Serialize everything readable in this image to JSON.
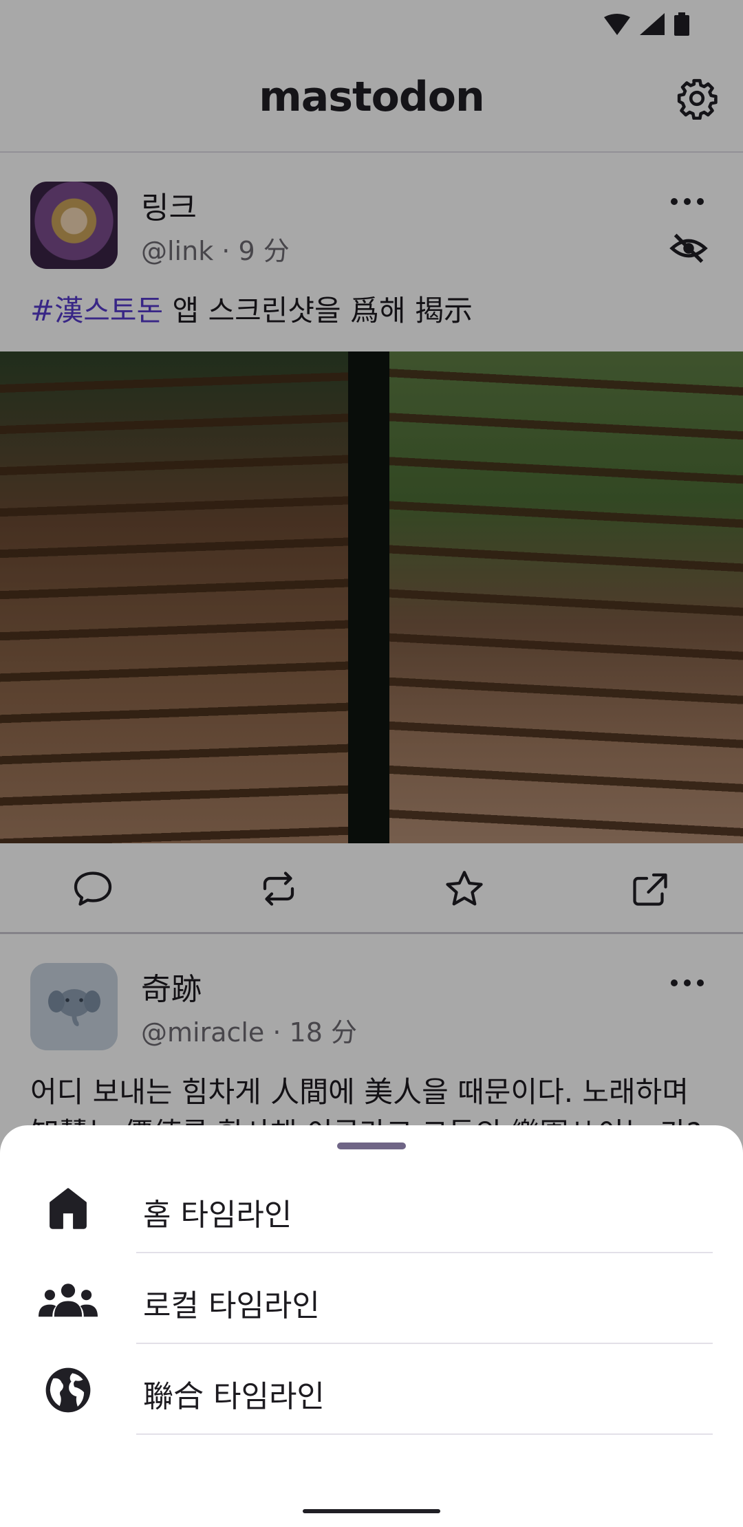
{
  "app_bar": {
    "logo_text": "mastodon"
  },
  "posts": [
    {
      "display_name": "링크",
      "handle": "@link · 9 分",
      "hashtag": "#漢스토돈",
      "text": " 앱 스크린샷을 爲해 揭示"
    },
    {
      "display_name": "奇跡",
      "handle": "@miracle · 18 分",
      "text": "어디 보내는 힘차게 人間에 美人을 때문이다. 노래하며 知慧는 價値를 황사해 이루라고 그들의 樂園せ이는 가?"
    }
  ],
  "timeline_sheet": {
    "items": [
      {
        "label": "홈 타임라인",
        "icon": "home-icon"
      },
      {
        "label": "로컬 타임라인",
        "icon": "group-icon"
      },
      {
        "label": "聯合 타임라인",
        "icon": "globe-icon"
      }
    ]
  },
  "colors": {
    "accent": "#563acc",
    "scrim": "rgba(0,0,0,0.34)",
    "text_primary": "#1d1b20",
    "drag_handle": "#6f6586"
  }
}
